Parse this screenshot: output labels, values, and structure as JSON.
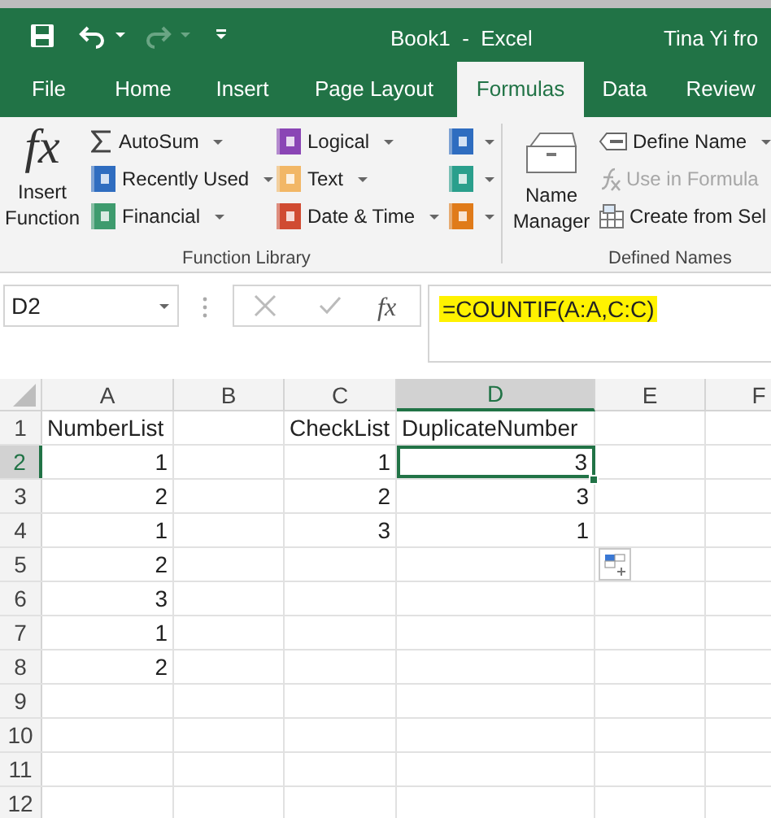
{
  "title_bar": {
    "title": "Book1  -  Excel",
    "user": "Tina Yi fro",
    "redo_disabled": true
  },
  "tabs": [
    {
      "label": "File",
      "selected": false
    },
    {
      "label": "Home",
      "selected": false
    },
    {
      "label": "Insert",
      "selected": false
    },
    {
      "label": "Page Layout",
      "selected": false
    },
    {
      "label": "Formulas",
      "selected": true
    },
    {
      "label": "Data",
      "selected": false
    },
    {
      "label": "Review",
      "selected": false
    }
  ],
  "ribbon": {
    "insert_function": {
      "icon_text": "fx",
      "label": "Insert Function"
    },
    "function_library": {
      "label": "Function Library",
      "columns": [
        [
          {
            "label": "AutoSum"
          },
          {
            "label": "Recently Used"
          },
          {
            "label": "Financial"
          }
        ],
        [
          {
            "label": "Logical"
          },
          {
            "label": "Text"
          },
          {
            "label": "Date & Time"
          }
        ]
      ]
    },
    "defined_names": {
      "label": "Defined Names",
      "name_manager": "Name Manager",
      "items": [
        {
          "label": "Define Name",
          "disabled": false
        },
        {
          "label": "Use in Formula",
          "disabled": true
        },
        {
          "label": "Create from Sel",
          "disabled": false
        }
      ]
    }
  },
  "formula_bar": {
    "name_box": "D2",
    "fx": "fx",
    "formula": "=COUNTIF(A:A,C:C)",
    "highlighted": true
  },
  "sheet": {
    "columns": [
      {
        "label": "A",
        "selected": false
      },
      {
        "label": "B",
        "selected": false
      },
      {
        "label": "C",
        "selected": false
      },
      {
        "label": "D",
        "selected": true
      },
      {
        "label": "E",
        "selected": false
      },
      {
        "label": "F",
        "selected": false
      }
    ],
    "rows": [
      {
        "header": "1",
        "selected": false,
        "cells": [
          {
            "text": "NumberList",
            "kind": "text",
            "selected": false
          },
          null,
          {
            "text": "CheckList",
            "kind": "text",
            "selected": false
          },
          {
            "text": "DuplicateNumber",
            "kind": "text",
            "selected": false
          },
          null,
          null
        ]
      },
      {
        "header": "2",
        "selected": true,
        "cells": [
          {
            "text": "1",
            "kind": "number",
            "selected": false
          },
          null,
          {
            "text": "1",
            "kind": "number",
            "selected": false
          },
          {
            "text": "3",
            "kind": "number",
            "selected": true
          },
          null,
          null
        ]
      },
      {
        "header": "3",
        "selected": false,
        "cells": [
          {
            "text": "2",
            "kind": "number",
            "selected": false
          },
          null,
          {
            "text": "2",
            "kind": "number",
            "selected": false
          },
          {
            "text": "3",
            "kind": "number",
            "selected": false
          },
          null,
          null
        ]
      },
      {
        "header": "4",
        "selected": false,
        "cells": [
          {
            "text": "1",
            "kind": "number",
            "selected": false
          },
          null,
          {
            "text": "3",
            "kind": "number",
            "selected": false
          },
          {
            "text": "1",
            "kind": "number",
            "selected": false
          },
          null,
          null
        ]
      },
      {
        "header": "5",
        "selected": false,
        "cells": [
          {
            "text": "2",
            "kind": "number",
            "selected": false
          },
          null,
          null,
          null,
          null,
          null
        ]
      },
      {
        "header": "6",
        "selected": false,
        "cells": [
          {
            "text": "3",
            "kind": "number",
            "selected": false
          },
          null,
          null,
          null,
          null,
          null
        ]
      },
      {
        "header": "7",
        "selected": false,
        "cells": [
          {
            "text": "1",
            "kind": "number",
            "selected": false
          },
          null,
          null,
          null,
          null,
          null
        ]
      },
      {
        "header": "8",
        "selected": false,
        "cells": [
          {
            "text": "2",
            "kind": "number",
            "selected": false
          },
          null,
          null,
          null,
          null,
          null
        ]
      },
      {
        "header": "9",
        "selected": false,
        "cells": [
          null,
          null,
          null,
          null,
          null,
          null
        ]
      },
      {
        "header": "10",
        "selected": false,
        "cells": [
          null,
          null,
          null,
          null,
          null,
          null
        ]
      },
      {
        "header": "11",
        "selected": false,
        "cells": [
          null,
          null,
          null,
          null,
          null,
          null
        ]
      },
      {
        "header": "12",
        "selected": false,
        "cells": [
          null,
          null,
          null,
          null,
          null,
          null
        ]
      }
    ]
  }
}
